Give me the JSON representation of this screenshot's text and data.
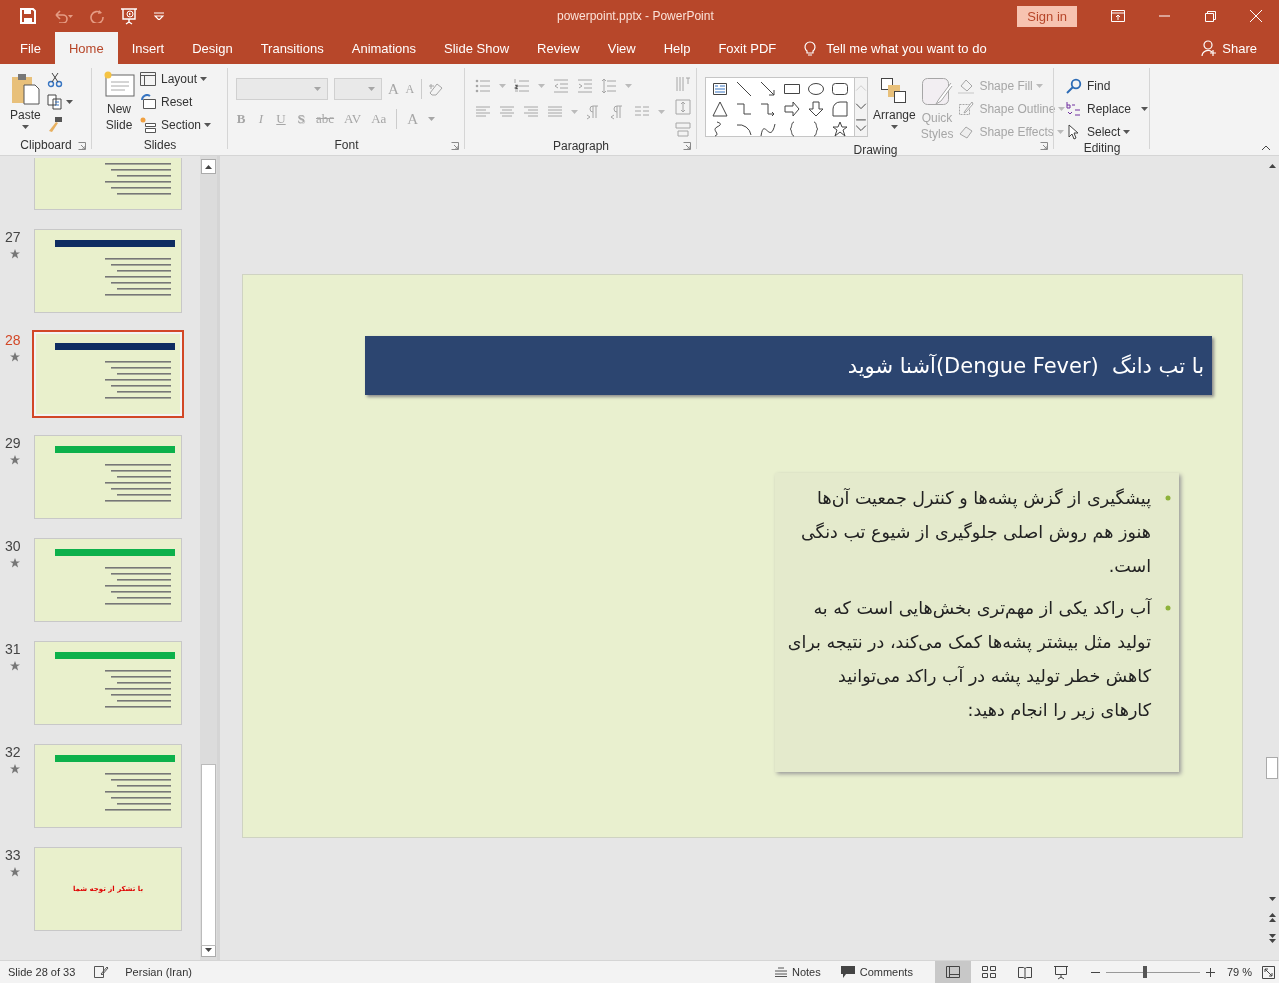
{
  "title_bar": {
    "title": "powerpoint.pptx  -  PowerPoint",
    "sign_in": "Sign in"
  },
  "tabs": [
    {
      "label": "File",
      "selected": false
    },
    {
      "label": "Home",
      "selected": true
    },
    {
      "label": "Insert",
      "selected": false
    },
    {
      "label": "Design",
      "selected": false
    },
    {
      "label": "Transitions",
      "selected": false
    },
    {
      "label": "Animations",
      "selected": false
    },
    {
      "label": "Slide Show",
      "selected": false
    },
    {
      "label": "Review",
      "selected": false
    },
    {
      "label": "View",
      "selected": false
    },
    {
      "label": "Help",
      "selected": false
    },
    {
      "label": "Foxit PDF",
      "selected": false
    }
  ],
  "tell_me": "Tell me what you want to do",
  "share": "Share",
  "ribbon": {
    "groups": [
      {
        "kind": "clipboard",
        "label": "Clipboard",
        "paste": "Paste"
      },
      {
        "kind": "slides",
        "label": "Slides",
        "new_slide": "New Slide",
        "layout": "Layout",
        "reset": "Reset",
        "section": "Section"
      },
      {
        "kind": "font",
        "label": "Font",
        "disabled": true,
        "size_buttons": [
          "A",
          "A"
        ],
        "format_buttons": [
          "B",
          "I",
          "U",
          "S",
          "abc",
          "AV",
          "Aa"
        ],
        "color_button": "A"
      },
      {
        "kind": "paragraph",
        "label": "Paragraph",
        "disabled": true
      },
      {
        "kind": "drawing",
        "label": "Drawing",
        "arrange": "Arrange",
        "quick_styles": "Quick Styles",
        "shape_fill": "Shape Fill",
        "shape_outline": "Shape Outline",
        "shape_effects": "Shape Effects",
        "styles_disabled": true
      },
      {
        "kind": "editing",
        "label": "Editing",
        "find": "Find",
        "replace": "Replace",
        "select": "Select"
      }
    ]
  },
  "thumbnails": [
    {
      "kind": "partial",
      "selected": false
    },
    {
      "kind": "content",
      "number": "27",
      "color": "#0f2d62",
      "selected": false
    },
    {
      "kind": "content",
      "number": "28",
      "color": "#0f2d62",
      "selected": true
    },
    {
      "kind": "content",
      "number": "29",
      "color": "#0db14b",
      "selected": false
    },
    {
      "kind": "content",
      "number": "30",
      "color": "#0db14b",
      "selected": false
    },
    {
      "kind": "content",
      "number": "31",
      "color": "#0db14b",
      "selected": false
    },
    {
      "kind": "content",
      "number": "32",
      "color": "#0db14b",
      "selected": false
    },
    {
      "kind": "closing",
      "number": "33",
      "caption": "با تشکر از توجه شما",
      "selected": false
    }
  ],
  "slide": {
    "title": "با تب دانگ  (Dengue Fever)آشنا شوید",
    "bullets": [
      "پیشگیری از گزش پشه‌ها و کنترل جمعیت آن‌ها هنوز هم روش اصلی جلوگیری از شیوع تب دنگی است.",
      "آب راکد یکی از مهم‌تری بخش‌هایی است که به تولید مثل بیشتر پشه‌ها کمک می‌کند، در نتیجه برای کاهش خطر تولید پشه در آب راکد می‌توانید کارهای زیر را انجام دهید:"
    ]
  },
  "status_bar": {
    "slide": "Slide 28 of 33",
    "language": "Persian (Iran)",
    "notes": "Notes",
    "comments": "Comments",
    "views": [
      {
        "selected": true
      },
      {
        "selected": false
      },
      {
        "selected": false
      },
      {
        "selected": false
      }
    ],
    "zoom": {
      "level": 0.42,
      "label": "79 %"
    }
  }
}
